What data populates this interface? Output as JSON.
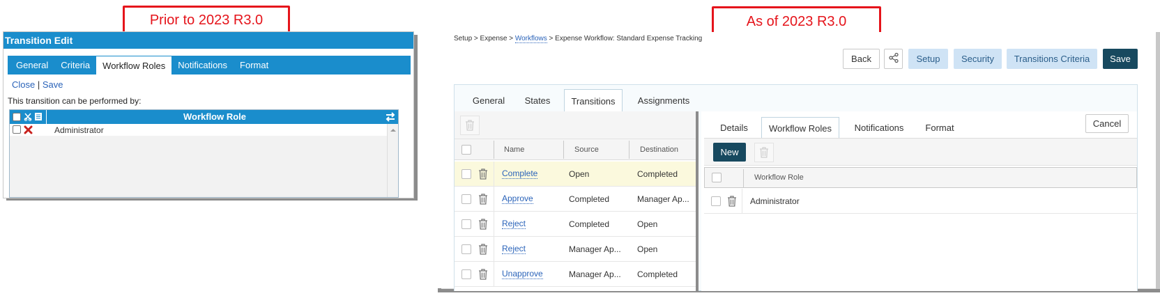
{
  "callouts": {
    "left": "Prior to 2023 R3.0",
    "right": "As of 2023 R3.0"
  },
  "old_ui": {
    "title": "Transition Edit",
    "tabs": [
      "General",
      "Criteria",
      "Workflow Roles",
      "Notifications",
      "Format"
    ],
    "active_tab": "Workflow Roles",
    "close_link": "Close",
    "link_separator": "|",
    "save_link": "Save",
    "caption": "This transition can be performed by:",
    "grid": {
      "column": "Workflow Role",
      "rows": [
        "Administrator"
      ]
    }
  },
  "new_ui": {
    "breadcrumb": {
      "prefix": "Setup > Expense > ",
      "link": "Workflows",
      "suffix": " > Expense Workflow: Standard Expense Tracking"
    },
    "toolbar": {
      "back": "Back",
      "setup": "Setup",
      "security": "Security",
      "transitions_criteria": "Transitions Criteria",
      "save": "Save"
    },
    "tabs": [
      "General",
      "States",
      "Transitions",
      "Assignments"
    ],
    "active_tab": "Transitions",
    "transitions_table": {
      "columns": [
        "Name",
        "Source",
        "Destination"
      ],
      "rows": [
        {
          "name": "Complete",
          "source": "Open",
          "destination": "Completed"
        },
        {
          "name": "Approve",
          "source": "Completed",
          "destination": "Manager Ap..."
        },
        {
          "name": "Reject",
          "source": "Completed",
          "destination": "Open"
        },
        {
          "name": "Reject",
          "source": "Manager Ap...",
          "destination": "Open"
        },
        {
          "name": "Unapprove",
          "source": "Manager Ap...",
          "destination": "Completed"
        }
      ]
    },
    "detail": {
      "tabs": [
        "Details",
        "Workflow Roles",
        "Notifications",
        "Format"
      ],
      "active_tab": "Workflow Roles",
      "cancel": "Cancel",
      "new": "New",
      "column": "Workflow Role",
      "rows": [
        "Administrator"
      ]
    }
  }
}
